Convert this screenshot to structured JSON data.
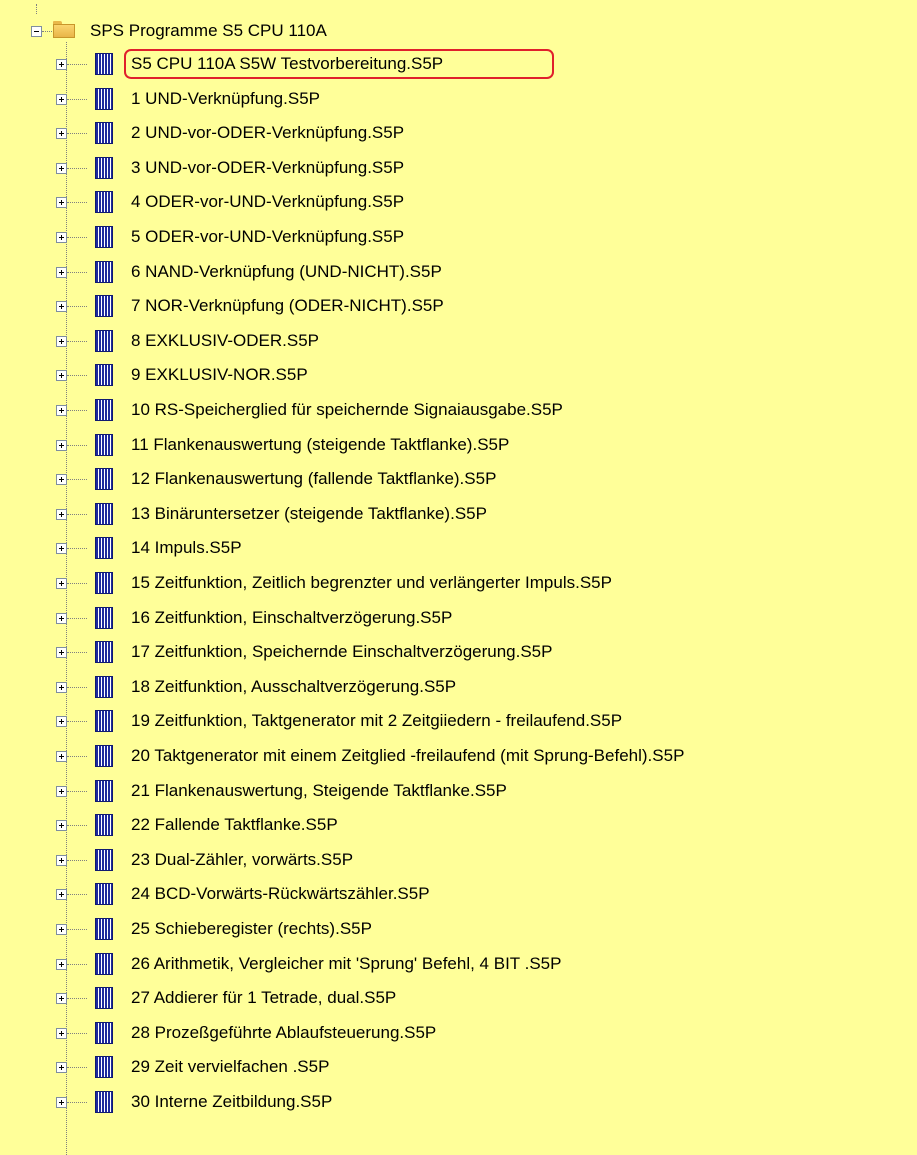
{
  "tree": {
    "root": {
      "label": "SPS Programme S5 CPU 110A",
      "icon": "folder-icon",
      "expanded": true
    },
    "children": [
      {
        "label": "S5 CPU 110A S5W Testvorbereitung.S5P",
        "highlighted": true
      },
      {
        "label": "1 UND-Verknüpfung.S5P"
      },
      {
        "label": "2 UND-vor-ODER-Verknüpfung.S5P"
      },
      {
        "label": "3 UND-vor-ODER-Verknüpfung.S5P"
      },
      {
        "label": "4 ODER-vor-UND-Verknüpfung.S5P"
      },
      {
        "label": "5 ODER-vor-UND-Verknüpfung.S5P"
      },
      {
        "label": "6 NAND-Verknüpfung (UND-NICHT).S5P"
      },
      {
        "label": "7 NOR-Verknüpfung (ODER-NICHT).S5P"
      },
      {
        "label": "8 EXKLUSIV-ODER.S5P"
      },
      {
        "label": "9 EXKLUSIV-NOR.S5P"
      },
      {
        "label": "10 RS-Speicherglied für speichernde Signaiausgabe.S5P"
      },
      {
        "label": "11 Flankenauswertung (steigende Taktflanke).S5P"
      },
      {
        "label": "12 Flankenauswertung (fallende Taktflanke).S5P"
      },
      {
        "label": "13 Binäruntersetzer (steigende Taktflanke).S5P"
      },
      {
        "label": "14 Impuls.S5P"
      },
      {
        "label": "15 Zeitfunktion, Zeitlich begrenzter und verlängerter Impuls.S5P"
      },
      {
        "label": "16 Zeitfunktion, Einschaltverzögerung.S5P"
      },
      {
        "label": "17 Zeitfunktion, Speichernde Einschaltverzögerung.S5P"
      },
      {
        "label": "18 Zeitfunktion, Ausschaltverzögerung.S5P"
      },
      {
        "label": "19 Zeitfunktion, Taktgenerator mit 2 Zeitgiiedern - freilaufend.S5P"
      },
      {
        "label": "20 Taktgenerator mit einem Zeitglied -freilaufend (mit Sprung-Befehl).S5P"
      },
      {
        "label": "21 Flankenauswertung, Steigende Taktflanke.S5P"
      },
      {
        "label": "22 Fallende Taktflanke.S5P"
      },
      {
        "label": "23 Dual-Zähler, vorwärts.S5P"
      },
      {
        "label": "24 BCD-Vorwärts-Rückwärtszähler.S5P"
      },
      {
        "label": "25 Schieberegister (rechts).S5P"
      },
      {
        "label": "26 Arithmetik, Vergleicher mit 'Sprung' Befehl, 4 BIT .S5P"
      },
      {
        "label": "27 Addierer für 1 Tetrade, dual.S5P"
      },
      {
        "label": "28 Prozeßgeführte Ablaufsteuerung.S5P"
      },
      {
        "label": "29 Zeit vervielfachen .S5P"
      },
      {
        "label": "30 Interne Zeitbildung.S5P"
      }
    ],
    "child_icon": "s5-project-file-icon",
    "colors": {
      "background": "#ffff99",
      "highlight_border": "#e0202c",
      "file_icon": "#1e2a9e"
    }
  }
}
